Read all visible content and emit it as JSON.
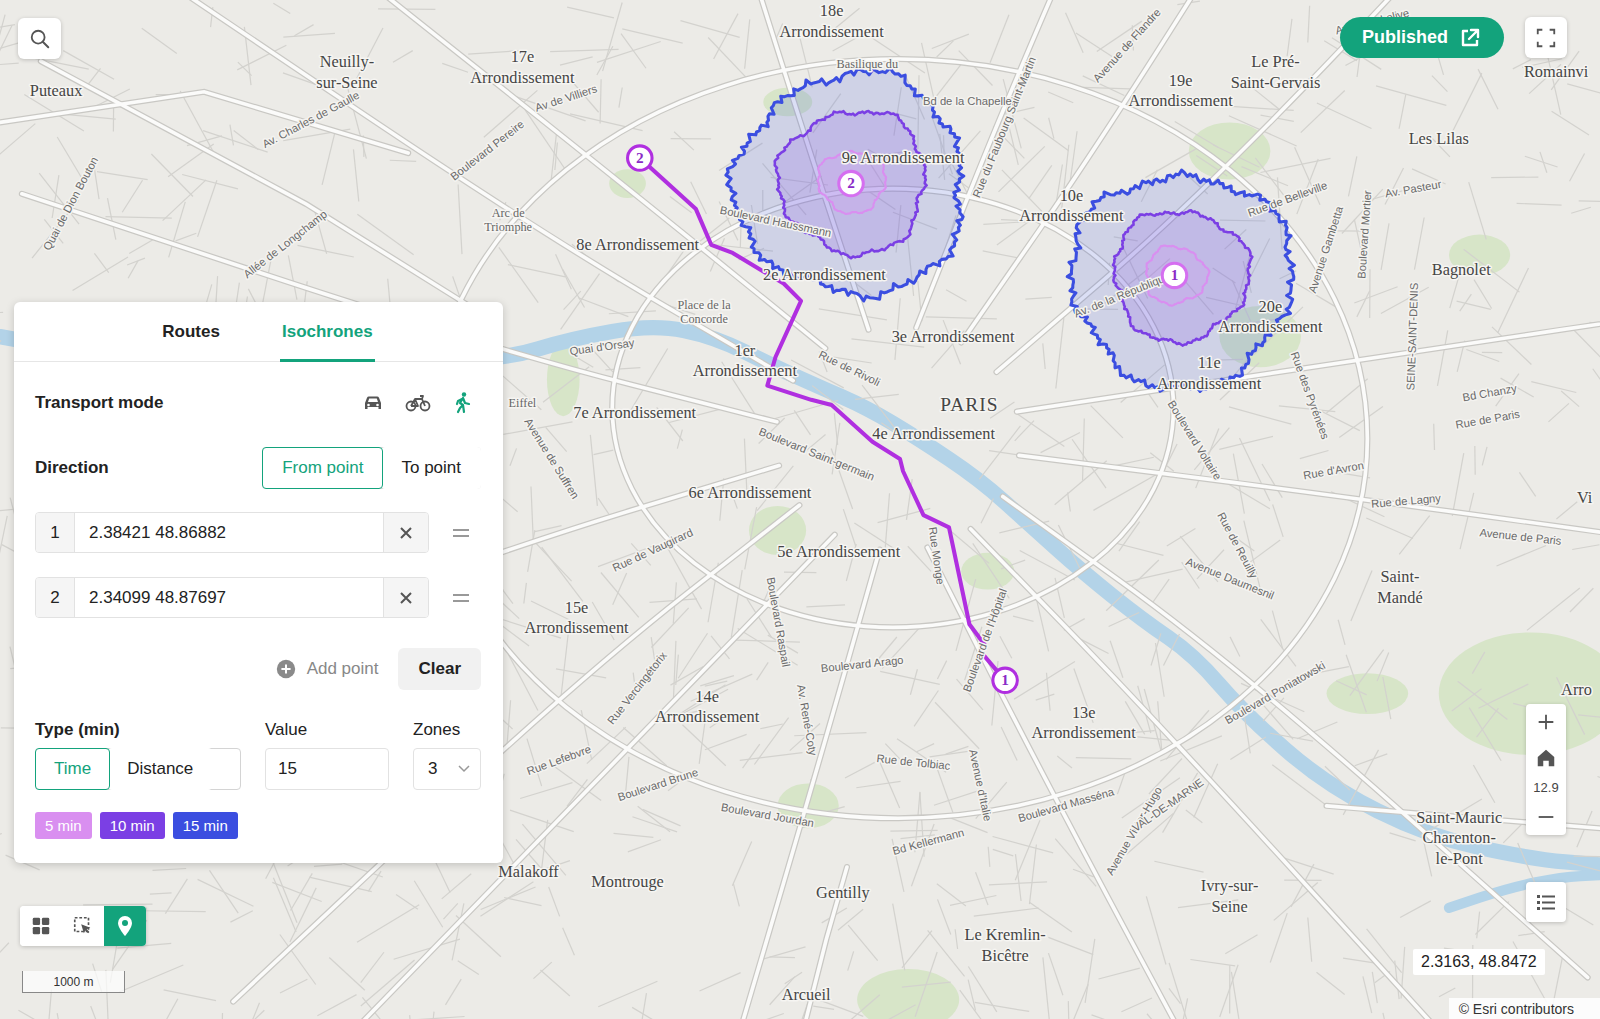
{
  "map": {
    "place_labels": [
      {
        "lines": [
          "18e",
          "Arrondissement"
        ],
        "kind": "area"
      },
      {
        "lines": [
          "17e",
          "Arrondissement"
        ],
        "kind": "area"
      },
      {
        "lines": [
          "Neuilly-",
          "sur-Seine"
        ],
        "kind": "area"
      },
      {
        "lines": [
          "Puteaux"
        ],
        "kind": "area"
      },
      {
        "lines": [
          "Le Pré-",
          "Saint-Gervais"
        ],
        "kind": "area"
      },
      {
        "lines": [
          "19e",
          "Arrondissement"
        ],
        "kind": "area"
      },
      {
        "lines": [
          "Romainvi"
        ],
        "kind": "area"
      },
      {
        "lines": [
          "Les Lilas"
        ],
        "kind": "area"
      },
      {
        "lines": [
          "Basilique du"
        ],
        "kind": "landmark"
      },
      {
        "lines": [
          "9e Arrondissement"
        ],
        "kind": "area"
      },
      {
        "lines": [
          "10e",
          "Arrondissement"
        ],
        "kind": "area"
      },
      {
        "lines": [
          "8e Arrondissement"
        ],
        "kind": "area"
      },
      {
        "lines": [
          "2e Arrondissement"
        ],
        "kind": "area"
      },
      {
        "lines": [
          "Arc de",
          "Triomphe"
        ],
        "kind": "landmark"
      },
      {
        "lines": [
          "Place de la",
          "Concorde"
        ],
        "kind": "landmark"
      },
      {
        "lines": [
          "Bagnolet"
        ],
        "kind": "area"
      },
      {
        "lines": [
          "20e",
          "Arrondissement"
        ],
        "kind": "area"
      },
      {
        "lines": [
          "11e",
          "Arrondissement"
        ],
        "kind": "area"
      },
      {
        "lines": [
          "3e Arrondissement"
        ],
        "kind": "area"
      },
      {
        "lines": [
          "1er",
          "Arrondissement"
        ],
        "kind": "area"
      },
      {
        "lines": [
          "PARIS"
        ],
        "kind": "capital"
      },
      {
        "lines": [
          "4e Arrondissement"
        ],
        "kind": "area"
      },
      {
        "lines": [
          "7e Arrondissement"
        ],
        "kind": "area"
      },
      {
        "lines": [
          "Eiffel"
        ],
        "kind": "landmark"
      },
      {
        "lines": [
          "6e Arrondissement"
        ],
        "kind": "area"
      },
      {
        "lines": [
          "5e Arrondissement"
        ],
        "kind": "area"
      },
      {
        "lines": [
          "15e",
          "Arrondissement"
        ],
        "kind": "area"
      },
      {
        "lines": [
          "Saint-",
          "Mandé"
        ],
        "kind": "area"
      },
      {
        "lines": [
          "14e",
          "Arrondissement"
        ],
        "kind": "area"
      },
      {
        "lines": [
          "13e",
          "Arrondissement"
        ],
        "kind": "area"
      },
      {
        "lines": [
          "Arro"
        ],
        "kind": "area"
      },
      {
        "lines": [
          "Malakoff"
        ],
        "kind": "area"
      },
      {
        "lines": [
          "Montrouge"
        ],
        "kind": "area"
      },
      {
        "lines": [
          "Gentilly"
        ],
        "kind": "area"
      },
      {
        "lines": [
          "Ivry-sur-",
          "Seine"
        ],
        "kind": "area"
      },
      {
        "lines": [
          "Saint-Mauric",
          "Charenton-",
          "le-Pont"
        ],
        "kind": "area"
      },
      {
        "lines": [
          "Le Kremlin-",
          "Bicêtre"
        ],
        "kind": "area"
      },
      {
        "lines": [
          "Arcueil"
        ],
        "kind": "area"
      },
      {
        "lines": [
          "Vi"
        ],
        "kind": "area"
      }
    ],
    "street_labels": [
      "Av. Charles de Gaulle",
      "Boulevard Pereire",
      "Av de Villiers",
      "Quai de Dion Bouton",
      "Allée de Longchamp",
      "Boulevard Haussmann",
      "Quai d'Orsay",
      "Rue de Rivoli",
      "Boulevard Saint-germain",
      "Rue du Faubourg Saint-Martin",
      "Avenue de Flandre",
      "Av. Jean-Lolive",
      "Rue de Belleville",
      "Av. Pasteur",
      "Avenue Gambetta",
      "Boulevard Mortier",
      "Boulevard Voltaire",
      "Rue des Pyrénées",
      "Rue d'Avron",
      "Bd Chanzy",
      "Rue de Paris",
      "Rue de Lagny",
      "Avenue de Paris",
      "Avenue Daumesnil",
      "Rue de Reuilly",
      "Boulevard de l'Hôpital",
      "Rue Monge",
      "Boulevard Arago",
      "Rue de Tolbiac",
      "Avenue d'Italie",
      "Boulevard Masséna",
      "Boulevard Jourdan",
      "Bd Kellermann",
      "Boulevard Poniatowski",
      "Rue de Vaugirard",
      "Avenue de Suffren",
      "Boulevard Raspail",
      "Av. René-Coty",
      "Rue Vercingétorix",
      "Boulevard Brune",
      "Rue Lefebvre",
      "Avenue Victor-Hugo",
      "SEINE-SAINT-DENIS",
      "Bd de la Chapelle",
      "Av. de la République",
      "VAL-DE-MARNE"
    ],
    "route": {
      "stops": [
        {
          "label": "1"
        },
        {
          "label": "2"
        }
      ]
    },
    "isochrones": [
      {
        "label": "1"
      },
      {
        "label": "2"
      }
    ]
  },
  "controls": {
    "published": "Published",
    "zoom_level": "12.9",
    "coordinates": "2.3163, 48.8472",
    "scale": "1000 m",
    "attribution": "© Esri contributors"
  },
  "tools": [
    {
      "kind": "grid",
      "selected": false
    },
    {
      "kind": "select",
      "selected": false
    },
    {
      "kind": "pin",
      "selected": true
    }
  ],
  "panel": {
    "tabs": [
      {
        "label": "Routes",
        "selected": false
      },
      {
        "label": "Isochrones",
        "selected": true
      }
    ],
    "transport_mode": {
      "label": "Transport mode",
      "modes": [
        {
          "kind": "car",
          "selected": false
        },
        {
          "kind": "bike",
          "selected": false
        },
        {
          "kind": "walk",
          "selected": true
        }
      ]
    },
    "direction": {
      "label": "Direction",
      "options": [
        {
          "label": "From point",
          "selected": true
        },
        {
          "label": "To point",
          "selected": false
        }
      ]
    },
    "points": [
      {
        "index": "1",
        "value": "2.38421 48.86882"
      },
      {
        "index": "2",
        "value": "2.34099 48.87697"
      }
    ],
    "add_point": "Add point",
    "clear": "Clear",
    "type": {
      "label": "Type (min)",
      "options": [
        {
          "label": "Time",
          "selected": true
        },
        {
          "label": "Distance",
          "selected": false
        }
      ]
    },
    "value": {
      "label": "Value",
      "value": "15"
    },
    "zones": {
      "label": "Zones",
      "value": "3"
    },
    "zone_chips": [
      {
        "label": "5 min",
        "color": "#d98ff0"
      },
      {
        "label": "10 min",
        "color": "#7b3fe4"
      },
      {
        "label": "15 min",
        "color": "#3b4ee0"
      }
    ]
  }
}
